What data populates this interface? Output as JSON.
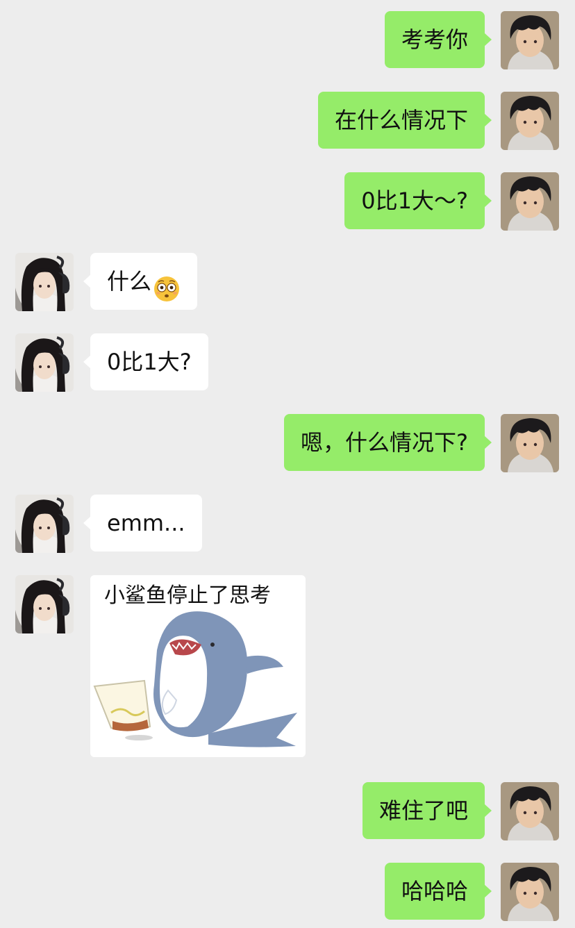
{
  "theme": {
    "background": "#ededed",
    "outgoing_bubble": "#95ec69",
    "incoming_bubble": "#ffffff"
  },
  "messages": [
    {
      "side": "out",
      "text": "考考你"
    },
    {
      "side": "out",
      "text": "在什么情况下"
    },
    {
      "side": "out",
      "text": "0比1大～?"
    },
    {
      "side": "in",
      "text": "什么",
      "emoji": "flushed-face-icon"
    },
    {
      "side": "in",
      "text": "0比1大?"
    },
    {
      "side": "out",
      "text": "嗯，什么情况下?"
    },
    {
      "side": "in",
      "text": "emm..."
    },
    {
      "side": "in",
      "sticker_caption": "小鲨鱼停止了思考",
      "sticker_icon": "shark-sticker-icon"
    },
    {
      "side": "out",
      "text": "难住了吧"
    },
    {
      "side": "out",
      "text": "哈哈哈"
    }
  ],
  "avatars": {
    "out": "boy-avatar-icon",
    "in": "girl-headphones-avatar-icon"
  }
}
